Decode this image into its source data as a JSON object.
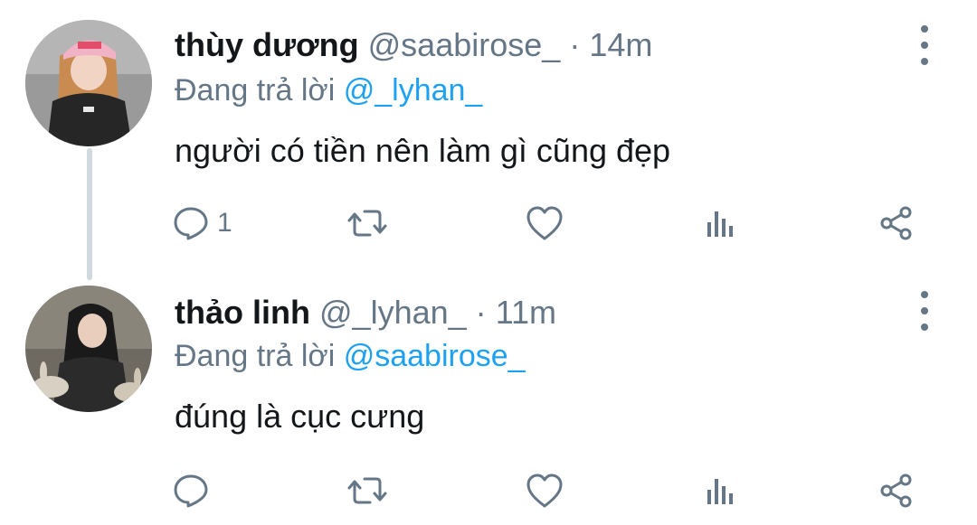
{
  "thread": {
    "tweets": [
      {
        "display_name": "thùy dương",
        "handle": "@saabirose_",
        "separator": "·",
        "time": "14m",
        "replying_prefix": "Đang trả lời",
        "replying_to": "@_lyhan_",
        "text": "người có tiền nên làm gì cũng đẹp",
        "reply_count": "1",
        "avatar_icon": "avatar-photo-pink-cap"
      },
      {
        "display_name": "thảo linh",
        "handle": "@_lyhan_",
        "separator": "·",
        "time": "11m",
        "replying_prefix": "Đang trả lời",
        "replying_to": "@saabirose_",
        "text": "đúng là cục cưng",
        "reply_count": "",
        "avatar_icon": "avatar-photo-with-rabbits"
      }
    ]
  },
  "colors": {
    "text_primary": "#14171a",
    "text_secondary": "#657786",
    "mention": "#1da1f2",
    "thread_line": "#cfd9de"
  },
  "icons": {
    "reply": "reply-icon",
    "retweet": "retweet-icon",
    "like": "like-icon",
    "views": "views-icon",
    "share": "share-icon",
    "more": "more-vertical-icon"
  }
}
